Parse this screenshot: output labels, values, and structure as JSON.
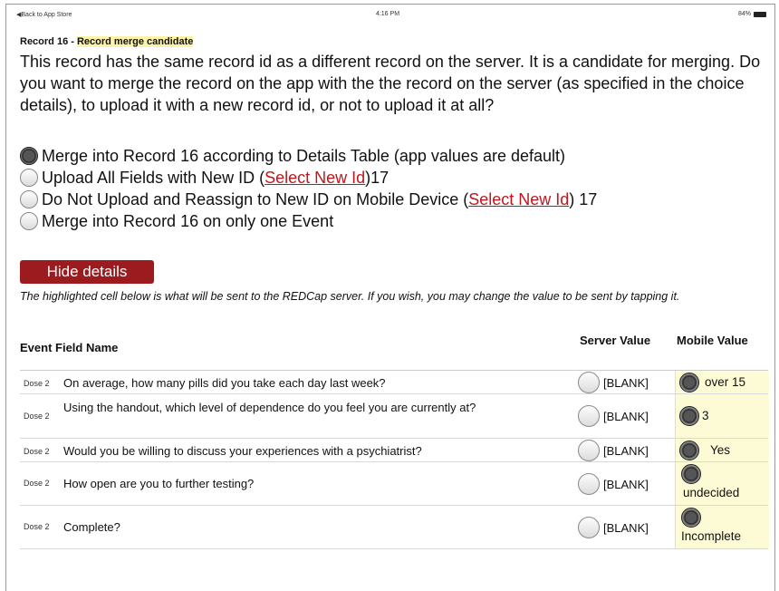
{
  "status_bar": {
    "back_label": "◀Back to App Store",
    "time": "4:16 PM",
    "battery": "84%"
  },
  "record": {
    "heading_prefix": "Record 16 - ",
    "heading_highlight": "Record merge candidate"
  },
  "explanation": "This record has the same record id as a different record on the server. It is a candidate for merging. Do you want to merge the record on the app with the the record on the server (as specified in the choice details), to upload it with a new record id, or not to upload it at all?",
  "options": [
    {
      "label": "Merge into Record 16 according to Details Table (app values are default)",
      "selected": true
    },
    {
      "label_before": "Upload All Fields with New ID (",
      "link": "Select New Id",
      "label_after": ")17",
      "selected": false
    },
    {
      "label_before": "Do Not Upload and Reassign to New ID on Mobile Device (",
      "link": "Select New Id",
      "label_after": ") 17",
      "selected": false
    },
    {
      "label": "Merge into Record 16 on only one Event",
      "selected": false
    }
  ],
  "hide_details_label": "Hide details",
  "note": "The highlighted cell below is what will be sent to the REDCap server. If you wish, you may change the value to be sent by tapping it.",
  "table": {
    "headers": {
      "event_field": "Event Field Name",
      "server": "Server Value",
      "mobile": "Mobile Value"
    },
    "rows": [
      {
        "event": "Dose 2",
        "field": "On average, how many pills did you take each day last week?",
        "server": "[BLANK]",
        "mobile": "over 15"
      },
      {
        "event": "Dose 2",
        "field": "Using the handout, which level of dependence do you feel you are currently at?",
        "server": "[BLANK]",
        "mobile": "3"
      },
      {
        "event": "Dose 2",
        "field": "Would you be willing to discuss your experiences with a psychiatrist?",
        "server": "[BLANK]",
        "mobile": "Yes"
      },
      {
        "event": "Dose 2",
        "field": "How open are you to further testing?",
        "server": "[BLANK]",
        "mobile": "undecided"
      },
      {
        "event": "Dose 2",
        "field": "Complete?",
        "server": "[BLANK]",
        "mobile": "Incomplete"
      }
    ]
  },
  "colors": {
    "hide_button": "#9b1b1f",
    "link": "#c0161b",
    "highlight": "#fdf3a8",
    "mobile_cell": "#fdfbd5"
  }
}
